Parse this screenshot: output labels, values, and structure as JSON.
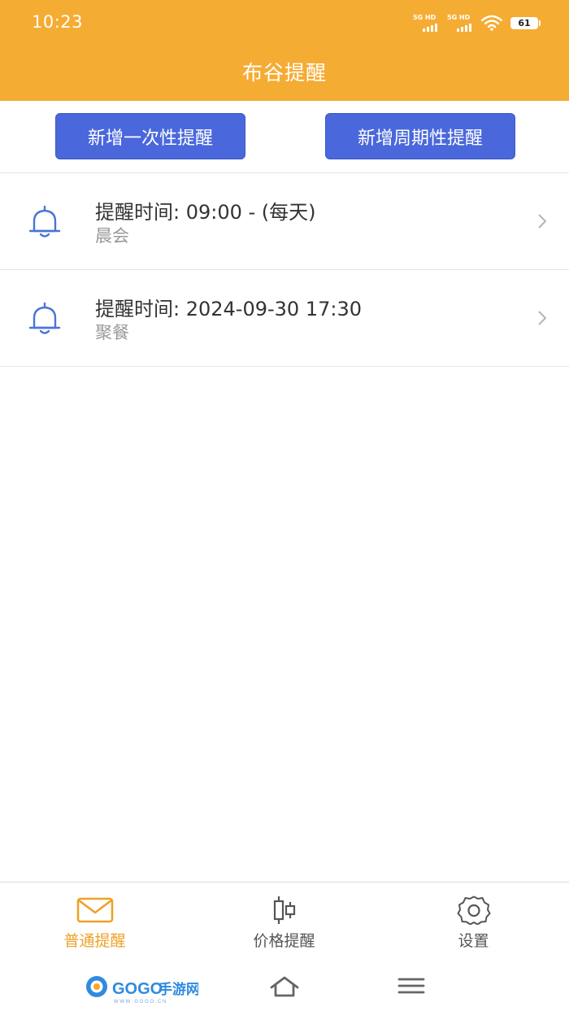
{
  "status_bar": {
    "time": "10:23",
    "signal_1_label": "5G HD",
    "signal_2_label": "5G HD",
    "battery_level": "61"
  },
  "header": {
    "title": "布谷提醒"
  },
  "actions": {
    "add_once_label": "新增一次性提醒",
    "add_cycle_label": "新增周期性提醒",
    "button_color": "#4A68DB"
  },
  "reminders": [
    {
      "time_text": "提醒时间: 09:00 - (每天)",
      "note": "晨会",
      "icon": "bell-icon"
    },
    {
      "time_text": "提醒时间: 2024-09-30 17:30",
      "note": "聚餐",
      "icon": "bell-icon"
    }
  ],
  "tabbar": {
    "tabs": [
      {
        "label": "普通提醒",
        "icon": "mail-icon",
        "active": true
      },
      {
        "label": "价格提醒",
        "icon": "candlestick-icon",
        "active": false
      },
      {
        "label": "设置",
        "icon": "gear-icon",
        "active": false
      }
    ],
    "active_color": "#EDA227"
  },
  "watermark": {
    "text": "GOGO手游网",
    "url_text": "WWW.GOGO.CN"
  },
  "theme": {
    "header_color": "#F5AC33",
    "bell_color": "#4A74D9"
  }
}
